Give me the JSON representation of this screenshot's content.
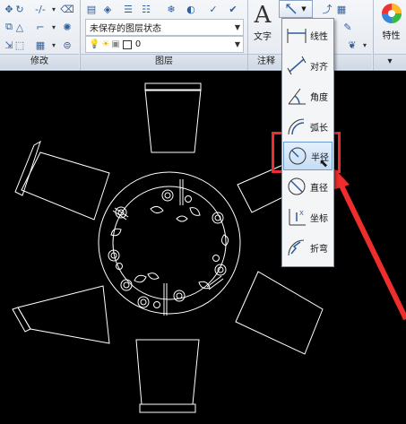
{
  "ribbon": {
    "panels": {
      "modify": "修改",
      "layers": "图层",
      "annotation": "注释"
    },
    "layer_state": "未保存的图层状态",
    "layer_value": "0",
    "text_tool": {
      "glyph": "A",
      "label": "文字"
    },
    "properties_tool": {
      "label": "特性"
    }
  },
  "dim_menu": {
    "items": [
      {
        "icon": "linear-dim-icon",
        "label": "线性"
      },
      {
        "icon": "aligned-dim-icon",
        "label": "对齐"
      },
      {
        "icon": "angular-dim-icon",
        "label": "角度"
      },
      {
        "icon": "arc-length-dim-icon",
        "label": "弧长"
      },
      {
        "icon": "radius-dim-icon",
        "label": "半径",
        "active": true
      },
      {
        "icon": "diameter-dim-icon",
        "label": "直径"
      },
      {
        "icon": "ordinate-dim-icon",
        "label": "坐标"
      },
      {
        "icon": "jogged-dim-icon",
        "label": "折弯"
      }
    ]
  },
  "colors": {
    "highlight": "#ee2d2d",
    "canvas": "#000000",
    "drawing": "#ffffff"
  }
}
